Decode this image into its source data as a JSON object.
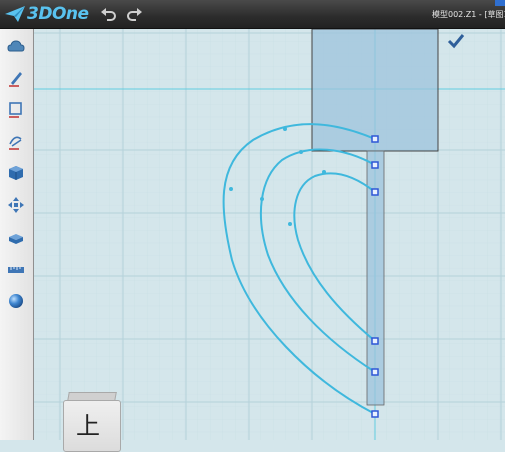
{
  "app": {
    "logo_text": "3DOne",
    "document_title": "模型002.Z1 - [草图1"
  },
  "toolbar": {
    "items": [
      {
        "name": "basic-shapes",
        "icon": "cloud-shape-icon"
      },
      {
        "name": "sketch",
        "icon": "pen-icon"
      },
      {
        "name": "sketch-edit",
        "icon": "sketch-square-icon"
      },
      {
        "name": "special-feature",
        "icon": "curve-edit-icon"
      },
      {
        "name": "feature-modeling",
        "icon": "cube-icon"
      },
      {
        "name": "basic-edit",
        "icon": "move-arrows-icon"
      },
      {
        "name": "combine-edit",
        "icon": "combine-icon"
      },
      {
        "name": "measure",
        "icon": "ruler-icon"
      },
      {
        "name": "material",
        "icon": "sphere-icon"
      }
    ]
  },
  "view_cube": {
    "face_label": "上"
  },
  "colors": {
    "grid_background": "#d4e6eb",
    "grid_line": "#b9d5dc",
    "axis_line": "#62cde0",
    "curve": "#3fb8dd",
    "selection_fill": "#9ec3dc",
    "handle": "#2e56d6",
    "accent": "#59c2ef"
  }
}
